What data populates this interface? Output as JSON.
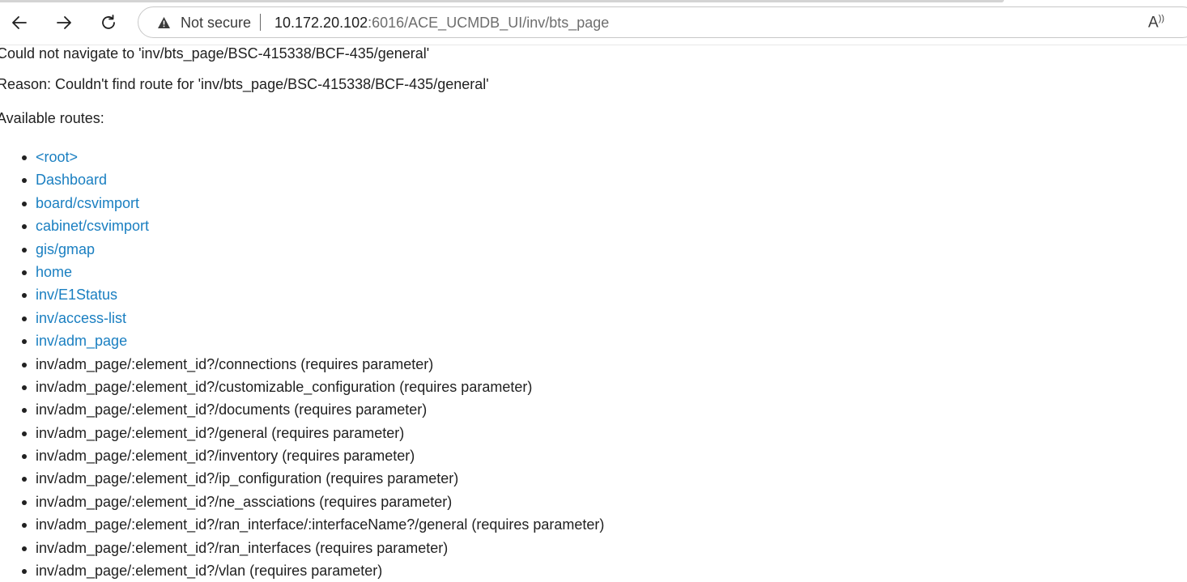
{
  "browser": {
    "security_label": "Not secure",
    "url_host": "10.172.20.102",
    "url_path": ":6016/ACE_UCMDB_UI/inv/bts_page",
    "read_aloud_glyph": "Aᵃ"
  },
  "page": {
    "error_line": "Could not navigate to 'inv/bts_page/BSC-415338/BCF-435/general'",
    "reason_line": "Reason: Couldn't find route for 'inv/bts_page/BSC-415338/BCF-435/general'",
    "routes_heading": "Available routes:",
    "link_color": "#1a7fc1",
    "routes": [
      {
        "label": "<root>",
        "link": true
      },
      {
        "label": "Dashboard",
        "link": true
      },
      {
        "label": "board/csvimport",
        "link": true
      },
      {
        "label": "cabinet/csvimport",
        "link": true
      },
      {
        "label": "gis/gmap",
        "link": true
      },
      {
        "label": "home",
        "link": true
      },
      {
        "label": "inv/E1Status",
        "link": true
      },
      {
        "label": "inv/access-list",
        "link": true
      },
      {
        "label": "inv/adm_page",
        "link": true
      },
      {
        "label": "inv/adm_page/:element_id?/connections (requires parameter)",
        "link": false
      },
      {
        "label": "inv/adm_page/:element_id?/customizable_configuration (requires parameter)",
        "link": false
      },
      {
        "label": "inv/adm_page/:element_id?/documents (requires parameter)",
        "link": false
      },
      {
        "label": "inv/adm_page/:element_id?/general (requires parameter)",
        "link": false
      },
      {
        "label": "inv/adm_page/:element_id?/inventory (requires parameter)",
        "link": false
      },
      {
        "label": "inv/adm_page/:element_id?/ip_configuration (requires parameter)",
        "link": false
      },
      {
        "label": "inv/adm_page/:element_id?/ne_assciations (requires parameter)",
        "link": false
      },
      {
        "label": "inv/adm_page/:element_id?/ran_interface/:interfaceName?/general (requires parameter)",
        "link": false
      },
      {
        "label": "inv/adm_page/:element_id?/ran_interfaces (requires parameter)",
        "link": false
      },
      {
        "label": "inv/adm_page/:element_id?/vlan (requires parameter)",
        "link": false
      }
    ]
  }
}
